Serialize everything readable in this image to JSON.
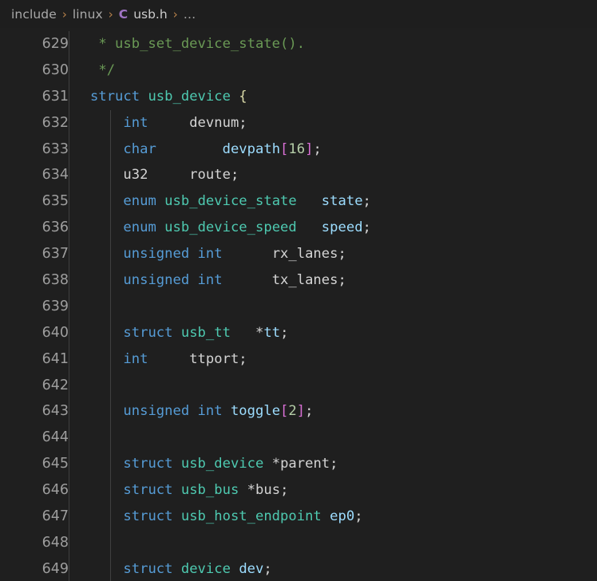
{
  "breadcrumb": {
    "name": "breadcrumb",
    "separator": "›",
    "ellipsis": "…",
    "items": [
      {
        "label": "include",
        "kind": "folder"
      },
      {
        "label": "linux",
        "kind": "folder"
      },
      {
        "label": "usb.h",
        "kind": "file",
        "icon": "C"
      }
    ]
  },
  "editor": {
    "language": "C",
    "filename": "usb.h",
    "first_line_number": 629,
    "lines": [
      {
        "number": "629",
        "indent_guides": 0,
        "text": " * usb_set_device_state().",
        "tokens": [
          {
            "t": " * usb_set_device_state().",
            "c": "cmt"
          }
        ]
      },
      {
        "number": "630",
        "indent_guides": 0,
        "text": " */",
        "tokens": [
          {
            "t": " */",
            "c": "cmt"
          }
        ]
      },
      {
        "number": "631",
        "indent_guides": 0,
        "text": "struct usb_device {",
        "tokens": [
          {
            "t": "struct",
            "c": "kw"
          },
          {
            "t": " ",
            "c": "pln"
          },
          {
            "t": "usb_device",
            "c": "typ"
          },
          {
            "t": " ",
            "c": "pln"
          },
          {
            "t": "{",
            "c": "cur"
          }
        ]
      },
      {
        "number": "632",
        "indent_guides": 1,
        "text": "    int\t\tdevnum;",
        "tokens": [
          {
            "t": "    ",
            "c": "pln"
          },
          {
            "t": "int",
            "c": "kw"
          },
          {
            "t": "     ",
            "c": "pln"
          },
          {
            "t": "devnum",
            "c": "pln"
          },
          {
            "t": ";",
            "c": "pln"
          }
        ]
      },
      {
        "number": "633",
        "indent_guides": 1,
        "text": "    char\t\tdevpath[16];",
        "tokens": [
          {
            "t": "    ",
            "c": "pln"
          },
          {
            "t": "char",
            "c": "kw"
          },
          {
            "t": "        ",
            "c": "pln"
          },
          {
            "t": "devpath",
            "c": "fld"
          },
          {
            "t": "[",
            "c": "brk"
          },
          {
            "t": "16",
            "c": "num"
          },
          {
            "t": "]",
            "c": "brk"
          },
          {
            "t": ";",
            "c": "pln"
          }
        ]
      },
      {
        "number": "634",
        "indent_guides": 1,
        "text": "    u32\t\troute;",
        "tokens": [
          {
            "t": "    ",
            "c": "pln"
          },
          {
            "t": "u32",
            "c": "pln"
          },
          {
            "t": "     ",
            "c": "pln"
          },
          {
            "t": "route",
            "c": "pln"
          },
          {
            "t": ";",
            "c": "pln"
          }
        ]
      },
      {
        "number": "635",
        "indent_guides": 1,
        "text": "    enum usb_device_state\tstate;",
        "tokens": [
          {
            "t": "    ",
            "c": "pln"
          },
          {
            "t": "enum",
            "c": "kw"
          },
          {
            "t": " ",
            "c": "pln"
          },
          {
            "t": "usb_device_state",
            "c": "typ"
          },
          {
            "t": "   ",
            "c": "pln"
          },
          {
            "t": "state",
            "c": "fld"
          },
          {
            "t": ";",
            "c": "pln"
          }
        ]
      },
      {
        "number": "636",
        "indent_guides": 1,
        "text": "    enum usb_device_speed\tspeed;",
        "tokens": [
          {
            "t": "    ",
            "c": "pln"
          },
          {
            "t": "enum",
            "c": "kw"
          },
          {
            "t": " ",
            "c": "pln"
          },
          {
            "t": "usb_device_speed",
            "c": "typ"
          },
          {
            "t": "   ",
            "c": "pln"
          },
          {
            "t": "speed",
            "c": "fld"
          },
          {
            "t": ";",
            "c": "pln"
          }
        ]
      },
      {
        "number": "637",
        "indent_guides": 1,
        "text": "    unsigned int\t\trx_lanes;",
        "tokens": [
          {
            "t": "    ",
            "c": "pln"
          },
          {
            "t": "unsigned int",
            "c": "kw"
          },
          {
            "t": "      ",
            "c": "pln"
          },
          {
            "t": "rx_lanes",
            "c": "pln"
          },
          {
            "t": ";",
            "c": "pln"
          }
        ]
      },
      {
        "number": "638",
        "indent_guides": 1,
        "text": "    unsigned int\t\ttx_lanes;",
        "tokens": [
          {
            "t": "    ",
            "c": "pln"
          },
          {
            "t": "unsigned int",
            "c": "kw"
          },
          {
            "t": "      ",
            "c": "pln"
          },
          {
            "t": "tx_lanes",
            "c": "pln"
          },
          {
            "t": ";",
            "c": "pln"
          }
        ]
      },
      {
        "number": "639",
        "indent_guides": 1,
        "text": "",
        "tokens": []
      },
      {
        "number": "640",
        "indent_guides": 1,
        "text": "    struct usb_tt\t*tt;",
        "tokens": [
          {
            "t": "    ",
            "c": "pln"
          },
          {
            "t": "struct",
            "c": "kw"
          },
          {
            "t": " ",
            "c": "pln"
          },
          {
            "t": "usb_tt",
            "c": "typ"
          },
          {
            "t": "   ",
            "c": "pln"
          },
          {
            "t": "*",
            "c": "pln"
          },
          {
            "t": "tt",
            "c": "fld"
          },
          {
            "t": ";",
            "c": "pln"
          }
        ]
      },
      {
        "number": "641",
        "indent_guides": 1,
        "text": "    int\t\tttport;",
        "tokens": [
          {
            "t": "    ",
            "c": "pln"
          },
          {
            "t": "int",
            "c": "kw"
          },
          {
            "t": "     ",
            "c": "pln"
          },
          {
            "t": "ttport",
            "c": "pln"
          },
          {
            "t": ";",
            "c": "pln"
          }
        ]
      },
      {
        "number": "642",
        "indent_guides": 1,
        "text": "",
        "tokens": []
      },
      {
        "number": "643",
        "indent_guides": 1,
        "text": "    unsigned int toggle[2];",
        "tokens": [
          {
            "t": "    ",
            "c": "pln"
          },
          {
            "t": "unsigned int",
            "c": "kw"
          },
          {
            "t": " ",
            "c": "pln"
          },
          {
            "t": "toggle",
            "c": "fld"
          },
          {
            "t": "[",
            "c": "brk"
          },
          {
            "t": "2",
            "c": "num"
          },
          {
            "t": "]",
            "c": "brk"
          },
          {
            "t": ";",
            "c": "pln"
          }
        ]
      },
      {
        "number": "644",
        "indent_guides": 1,
        "text": "",
        "tokens": []
      },
      {
        "number": "645",
        "indent_guides": 1,
        "text": "    struct usb_device *parent;",
        "tokens": [
          {
            "t": "    ",
            "c": "pln"
          },
          {
            "t": "struct",
            "c": "kw"
          },
          {
            "t": " ",
            "c": "pln"
          },
          {
            "t": "usb_device",
            "c": "typ"
          },
          {
            "t": " ",
            "c": "pln"
          },
          {
            "t": "*",
            "c": "pln"
          },
          {
            "t": "parent",
            "c": "pln"
          },
          {
            "t": ";",
            "c": "pln"
          }
        ]
      },
      {
        "number": "646",
        "indent_guides": 1,
        "text": "    struct usb_bus *bus;",
        "tokens": [
          {
            "t": "    ",
            "c": "pln"
          },
          {
            "t": "struct",
            "c": "kw"
          },
          {
            "t": " ",
            "c": "pln"
          },
          {
            "t": "usb_bus",
            "c": "typ"
          },
          {
            "t": " ",
            "c": "pln"
          },
          {
            "t": "*",
            "c": "pln"
          },
          {
            "t": "bus",
            "c": "pln"
          },
          {
            "t": ";",
            "c": "pln"
          }
        ]
      },
      {
        "number": "647",
        "indent_guides": 1,
        "text": "    struct usb_host_endpoint ep0;",
        "tokens": [
          {
            "t": "    ",
            "c": "pln"
          },
          {
            "t": "struct",
            "c": "kw"
          },
          {
            "t": " ",
            "c": "pln"
          },
          {
            "t": "usb_host_endpoint",
            "c": "typ"
          },
          {
            "t": " ",
            "c": "pln"
          },
          {
            "t": "ep0",
            "c": "fld"
          },
          {
            "t": ";",
            "c": "pln"
          }
        ]
      },
      {
        "number": "648",
        "indent_guides": 1,
        "text": "",
        "tokens": []
      },
      {
        "number": "649",
        "indent_guides": 1,
        "text": "    struct device dev;",
        "tokens": [
          {
            "t": "    ",
            "c": "pln"
          },
          {
            "t": "struct",
            "c": "kw"
          },
          {
            "t": " ",
            "c": "pln"
          },
          {
            "t": "device",
            "c": "typ"
          },
          {
            "t": " ",
            "c": "pln"
          },
          {
            "t": "dev",
            "c": "fld"
          },
          {
            "t": ";",
            "c": "pln"
          }
        ]
      }
    ]
  },
  "colors": {
    "background": "#1f1f1f",
    "breadcrumb_background": "#1e1e1e",
    "line_number": "#9d9d9d",
    "comment": "#6A9955",
    "keyword": "#569CD6",
    "type": "#4EC9B0",
    "field": "#9CDCFE",
    "plain": "#d4d4d4",
    "number": "#B5CEA8",
    "bracket": "#DA70D6",
    "curly_brace": "#DCDCAA",
    "separator": "#b5804a",
    "c_icon": "#a074c4",
    "indent_guide": "#404040"
  }
}
